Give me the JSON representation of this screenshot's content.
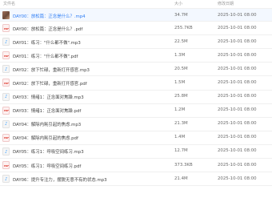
{
  "header": {
    "name": "文件名",
    "size": "大小",
    "date": "修改日期"
  },
  "rows": [
    {
      "icon": "video-thumbnail-icon",
      "name": "DAY00：放松篇：正念是什么？.mp4",
      "size": "34.7M",
      "date": "2025-10-01 08:00",
      "active": true
    },
    {
      "icon": "pdf-file-icon",
      "name": "DAY00：放松篇：正念是什么？.pdf",
      "size": "255.7KB",
      "date": "2025-10-01 08:00"
    },
    {
      "icon": "audio-file-icon",
      "name": "DAY01：练习：\"什么都不做\".mp3",
      "size": "22.5M",
      "date": "2025-10-01 08:00"
    },
    {
      "icon": "pdf-file-icon",
      "name": "DAY01：练习：\"什么都不做\".pdf",
      "size": "1.3M",
      "date": "2025-10-01 08:00"
    },
    {
      "icon": "audio-file-icon",
      "name": "DAY02：放下忙碌，重新打开感官.mp3",
      "size": "20.5M",
      "date": "2025-10-01 08:00"
    },
    {
      "icon": "pdf-file-icon",
      "name": "DAY02：放下忙碌，重新打开感官.pdf",
      "size": "1.5M",
      "date": "2025-10-01 08:00"
    },
    {
      "icon": "audio-file-icon",
      "name": "DAY03：情绪1：正念面对焦躁.mp3",
      "size": "25.8M",
      "date": "2025-10-01 08:00"
    },
    {
      "icon": "pdf-file-icon",
      "name": "DAY03：情绪1：正念面对焦躁.pdf",
      "size": "1.2M",
      "date": "2025-10-01 08:00"
    },
    {
      "icon": "audio-file-icon",
      "name": "DAY04：解除内耗引起的焦虑.mp3",
      "size": "21.3M",
      "date": "2025-10-01 08:00"
    },
    {
      "icon": "pdf-file-icon",
      "name": "DAY04：解除内耗引起的焦虑.pdf",
      "size": "1.4M",
      "date": "2025-10-01 08:00"
    },
    {
      "icon": "audio-file-icon",
      "name": "DAY05：练习1：呼吸空间练习.mp3",
      "size": "12.7M",
      "date": "2025-10-01 08:00"
    },
    {
      "icon": "pdf-file-icon",
      "name": "DAY05：练习1：呼吸空间练习.pdf",
      "size": "373.3KB",
      "date": "2025-10-01 08:00"
    },
    {
      "icon": "audio-file-icon",
      "name": "DAY06：提升专注力，摆脱无意不有的状态.mp3",
      "size": "21.4M",
      "date": "2025-10-01 08:00"
    }
  ],
  "glyphs": {
    "audio": "♪",
    "pdf": "PDF"
  }
}
